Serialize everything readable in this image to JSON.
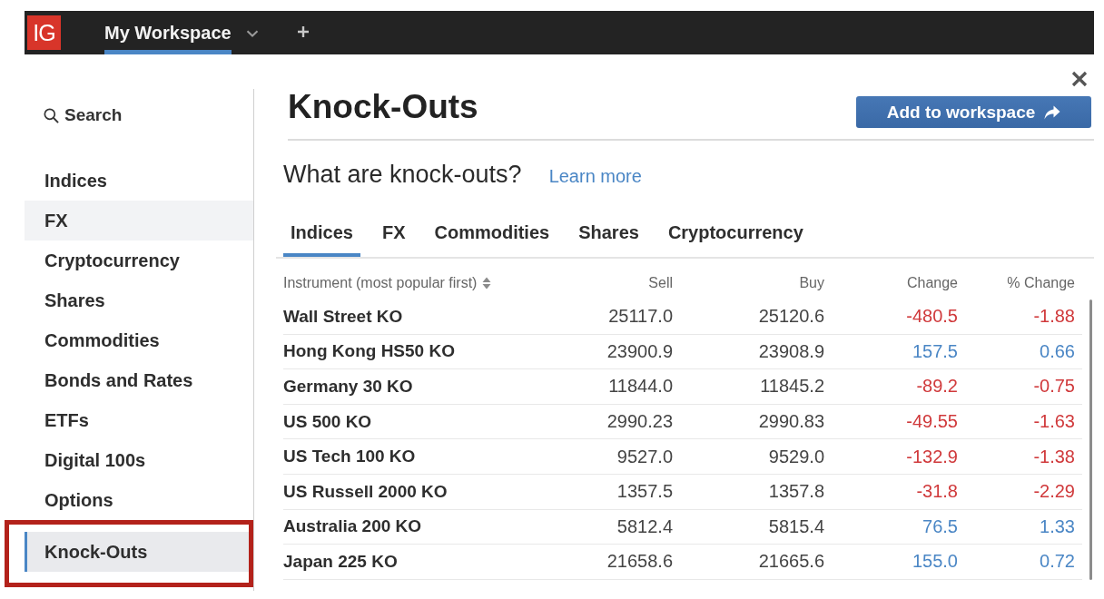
{
  "top_bar": {
    "logo": "IG",
    "workspace_tabs": [
      {
        "label": "My Workspace",
        "selected": true
      }
    ]
  },
  "sidebar": {
    "search_label": "Search",
    "items": [
      {
        "label": "Indices",
        "selected": false,
        "hovered": false,
        "highlighted": false
      },
      {
        "label": "FX",
        "selected": false,
        "hovered": true,
        "highlighted": false
      },
      {
        "label": "Cryptocurrency",
        "selected": false,
        "hovered": false,
        "highlighted": false
      },
      {
        "label": "Shares",
        "selected": false,
        "hovered": false,
        "highlighted": false
      },
      {
        "label": "Commodities",
        "selected": false,
        "hovered": false,
        "highlighted": false
      },
      {
        "label": "Bonds and Rates",
        "selected": false,
        "hovered": false,
        "highlighted": false
      },
      {
        "label": "ETFs",
        "selected": false,
        "hovered": false,
        "highlighted": false
      },
      {
        "label": "Digital 100s",
        "selected": false,
        "hovered": false,
        "highlighted": false
      },
      {
        "label": "Options",
        "selected": false,
        "hovered": false,
        "highlighted": false
      },
      {
        "label": "Knock-Outs",
        "selected": true,
        "hovered": false,
        "highlighted": true
      }
    ]
  },
  "panel": {
    "title": "Knock-Outs",
    "add_button": "Add to workspace",
    "subtitle": "What are knock-outs?",
    "learn_more": "Learn more",
    "tabs": [
      {
        "label": "Indices",
        "selected": true
      },
      {
        "label": "FX",
        "selected": false
      },
      {
        "label": "Commodities",
        "selected": false
      },
      {
        "label": "Shares",
        "selected": false
      },
      {
        "label": "Cryptocurrency",
        "selected": false
      }
    ],
    "table": {
      "columns": [
        {
          "label": "Instrument (most popular first)",
          "sortable": true
        },
        {
          "label": "Sell"
        },
        {
          "label": "Buy"
        },
        {
          "label": "Change"
        },
        {
          "label": "% Change"
        }
      ],
      "rows": [
        {
          "instrument": "Wall Street KO",
          "sell": "25117.0",
          "buy": "25120.6",
          "change": "-480.5",
          "pct_change": "-1.88",
          "falling": true
        },
        {
          "instrument": "Hong Kong HS50 KO",
          "sell": "23900.9",
          "buy": "23908.9",
          "change": "157.5",
          "pct_change": "0.66",
          "falling": false
        },
        {
          "instrument": "Germany 30 KO",
          "sell": "11844.0",
          "buy": "11845.2",
          "change": "-89.2",
          "pct_change": "-0.75",
          "falling": true
        },
        {
          "instrument": "US 500 KO",
          "sell": "2990.23",
          "buy": "2990.83",
          "change": "-49.55",
          "pct_change": "-1.63",
          "falling": true
        },
        {
          "instrument": "US Tech 100 KO",
          "sell": "9527.0",
          "buy": "9529.0",
          "change": "-132.9",
          "pct_change": "-1.38",
          "falling": true
        },
        {
          "instrument": "US Russell 2000 KO",
          "sell": "1357.5",
          "buy": "1357.8",
          "change": "-31.8",
          "pct_change": "-2.29",
          "falling": true
        },
        {
          "instrument": "Australia 200 KO",
          "sell": "5812.4",
          "buy": "5815.4",
          "change": "76.5",
          "pct_change": "1.33",
          "falling": false
        },
        {
          "instrument": "Japan 225 KO",
          "sell": "21658.6",
          "buy": "21665.6",
          "change": "155.0",
          "pct_change": "0.72",
          "falling": false
        }
      ]
    }
  }
}
